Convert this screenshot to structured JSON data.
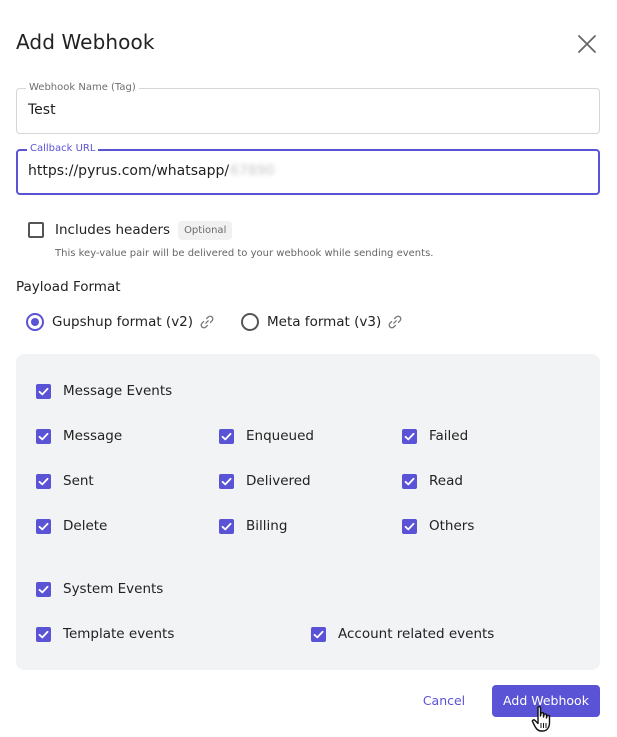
{
  "dialog": {
    "title": "Add Webhook",
    "close_icon": "close-icon"
  },
  "fields": {
    "name": {
      "label": "Webhook Name (Tag)",
      "value": "Test"
    },
    "callback": {
      "label": "Callback URL",
      "value": "https://pyrus.com/whatsapp/",
      "redacted": "67890"
    }
  },
  "headers": {
    "label": "Includes headers",
    "badge": "Optional",
    "help": "This key-value pair will be delivered to your webhook while sending events.",
    "checked": false
  },
  "payload": {
    "label": "Payload Format",
    "options": [
      {
        "label": "Gupshup format (v2)",
        "checked": true,
        "icon": "link-icon"
      },
      {
        "label": "Meta format (v3)",
        "checked": false,
        "icon": "link-icon"
      }
    ]
  },
  "events": {
    "message_group": {
      "label": "Message Events",
      "checked": true,
      "items": [
        {
          "label": "Message",
          "checked": true
        },
        {
          "label": "Enqueued",
          "checked": true
        },
        {
          "label": "Failed",
          "checked": true
        },
        {
          "label": "Sent",
          "checked": true
        },
        {
          "label": "Delivered",
          "checked": true
        },
        {
          "label": "Read",
          "checked": true
        },
        {
          "label": "Delete",
          "checked": true
        },
        {
          "label": "Billing",
          "checked": true
        },
        {
          "label": "Others",
          "checked": true
        }
      ]
    },
    "system_group": {
      "label": "System Events",
      "checked": true,
      "items": [
        {
          "label": "Template events",
          "checked": true
        },
        {
          "label": "Account related events",
          "checked": true
        }
      ]
    }
  },
  "footer": {
    "cancel_label": "Cancel",
    "submit_label": "Add Webhook"
  },
  "colors": {
    "accent": "#5b53d6",
    "panel_bg": "#f2f3f4"
  }
}
